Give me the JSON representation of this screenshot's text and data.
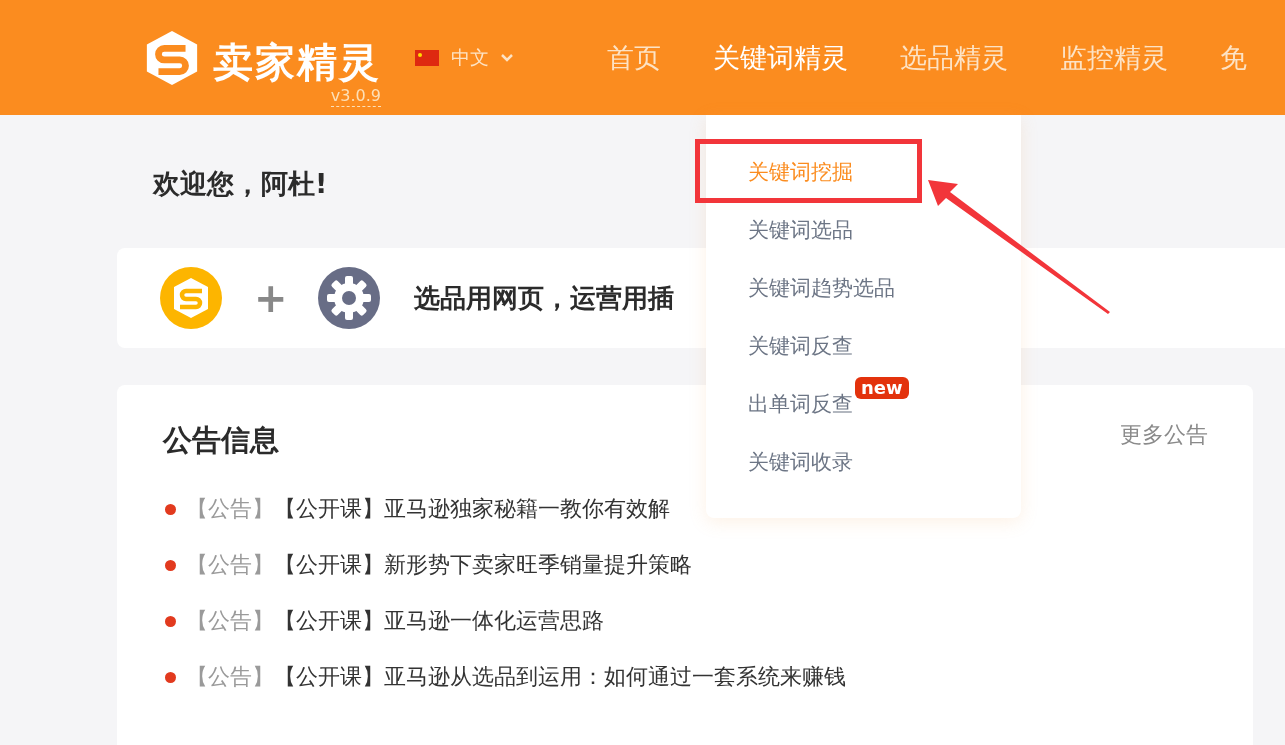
{
  "header": {
    "brand": "卖家精灵",
    "version": "v3.0.9",
    "language": "中文",
    "nav": [
      {
        "label": "首页",
        "selected": false
      },
      {
        "label": "关键词精灵",
        "selected": true
      },
      {
        "label": "选品精灵",
        "selected": false
      },
      {
        "label": "监控精灵",
        "selected": false
      },
      {
        "label": "免",
        "selected": false
      }
    ]
  },
  "welcome": "欢迎您，阿杜!",
  "promo": {
    "plus": "+",
    "text": "选品用网页，运营用插"
  },
  "announcements": {
    "title": "公告信息",
    "more": "更多公告",
    "items": [
      {
        "tag": "【公告】",
        "title": "【公开课】亚马逊独家秘籍一教你有效解"
      },
      {
        "tag": "【公告】",
        "title": "【公开课】新形势下卖家旺季销量提升策略"
      },
      {
        "tag": "【公告】",
        "title": "【公开课】亚马逊一体化运营思路"
      },
      {
        "tag": "【公告】",
        "title": "【公开课】亚马逊从选品到运用：如何通过一套系统来赚钱"
      }
    ]
  },
  "dropdown": {
    "items": [
      {
        "label": "关键词挖掘",
        "selected": true
      },
      {
        "label": "关键词选品",
        "selected": false
      },
      {
        "label": "关键词趋势选品",
        "selected": false
      },
      {
        "label": "关键词反查",
        "selected": false
      },
      {
        "label": "出单词反查",
        "selected": false,
        "badge": "new"
      },
      {
        "label": "关键词收录",
        "selected": false
      }
    ],
    "highlighted_item": true
  }
}
